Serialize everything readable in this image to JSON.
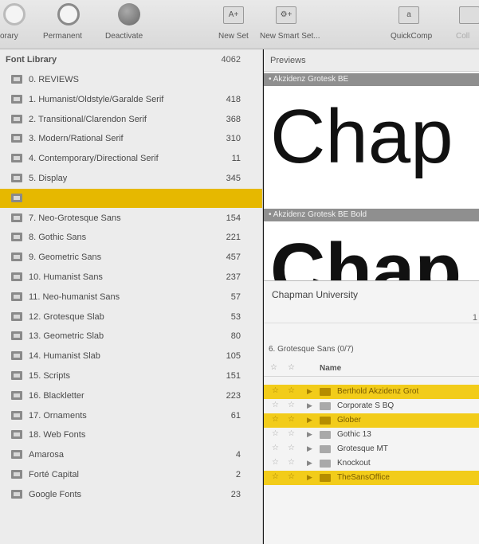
{
  "toolbar": {
    "items": [
      {
        "label": "orary",
        "icon": "library-icon"
      },
      {
        "label": "Permanent",
        "icon": "permanent-icon"
      },
      {
        "label": "Deactivate",
        "icon": "deactivate-icon"
      },
      {
        "label": "New Set",
        "icon": "new-set-icon"
      },
      {
        "label": "New Smart Set...",
        "icon": "new-smart-set-icon"
      },
      {
        "label": "QuickComp",
        "icon": "quickcomp-icon"
      },
      {
        "label": "Coll",
        "icon": "collection-icon"
      }
    ]
  },
  "sidebar": {
    "title": "Font Library",
    "total": "4062",
    "items": [
      {
        "name": "0. REVIEWS",
        "count": ""
      },
      {
        "name": "1. Humanist/Oldstyle/Garalde Serif",
        "count": "418"
      },
      {
        "name": "2. Transitional/Clarendon Serif",
        "count": "368"
      },
      {
        "name": "3. Modern/Rational Serif",
        "count": "310"
      },
      {
        "name": "4. Contemporary/Directional Serif",
        "count": "11"
      },
      {
        "name": "5. Display",
        "count": "345"
      },
      {
        "name": "",
        "count": "",
        "selected": true
      },
      {
        "name": "7. Neo-Grotesque Sans",
        "count": "154"
      },
      {
        "name": "8. Gothic Sans",
        "count": "221"
      },
      {
        "name": "9. Geometric Sans",
        "count": "457"
      },
      {
        "name": "10. Humanist Sans",
        "count": "237"
      },
      {
        "name": "11. Neo-humanist Sans",
        "count": "57"
      },
      {
        "name": "12. Grotesque Slab",
        "count": "53"
      },
      {
        "name": "13. Geometric Slab",
        "count": "80"
      },
      {
        "name": "14. Humanist Slab",
        "count": "105"
      },
      {
        "name": "15. Scripts",
        "count": "151"
      },
      {
        "name": "16. Blackletter",
        "count": "223"
      },
      {
        "name": "17. Ornaments",
        "count": "61"
      },
      {
        "name": "18. Web Fonts",
        "count": ""
      },
      {
        "name": "Amarosa",
        "count": "4"
      },
      {
        "name": "Forté Capital",
        "count": "2"
      },
      {
        "name": "Google Fonts",
        "count": "23"
      }
    ]
  },
  "previews": {
    "header": "Previews",
    "fonts": [
      {
        "name": "• Akzidenz Grotesk BE",
        "sample": "Chap"
      },
      {
        "name": "• Akzidenz Grotesk BE Bold",
        "sample": "Chap"
      }
    ]
  },
  "collection": {
    "title": "Chapman University",
    "corner_text": "1",
    "group_label": "6. Grotesque Sans (0/7)",
    "column_name": "Name",
    "star": "☆",
    "fonts": [
      {
        "name": "Berthold Akzidenz Grot",
        "highlighted": true
      },
      {
        "name": "Corporate S BQ",
        "highlighted": false
      },
      {
        "name": "Glober",
        "highlighted": true
      },
      {
        "name": "Gothic 13",
        "highlighted": false
      },
      {
        "name": "Grotesque MT",
        "highlighted": false
      },
      {
        "name": "Knockout",
        "highlighted": false
      },
      {
        "name": "TheSansOffice",
        "highlighted": true
      }
    ]
  },
  "colors": {
    "selection": "#e6b800",
    "highlight": "#f2cc1a",
    "sidebar_bg": "#ececec",
    "font_bar": "#8f8f8f"
  }
}
